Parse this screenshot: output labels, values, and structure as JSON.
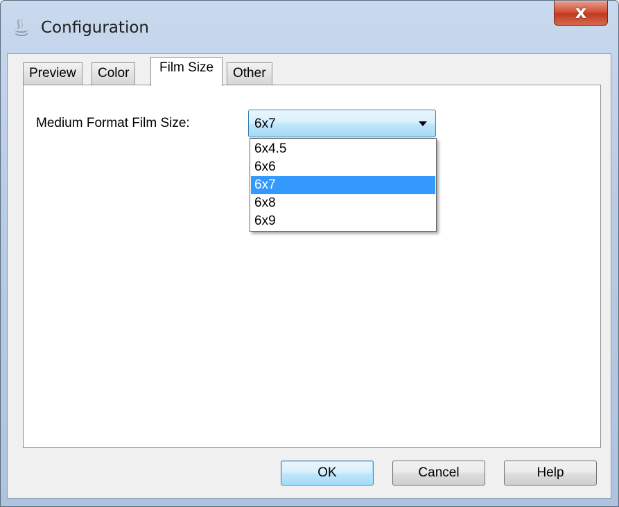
{
  "window": {
    "title": "Configuration",
    "close_label": "x"
  },
  "tabs": [
    {
      "label": "Preview",
      "active": false
    },
    {
      "label": "Color",
      "active": false
    },
    {
      "label": "Film Size",
      "active": true
    },
    {
      "label": "Other",
      "active": false
    }
  ],
  "film_size": {
    "label": "Medium Format Film Size:",
    "selected": "6x7",
    "options": [
      "6x4.5",
      "6x6",
      "6x7",
      "6x8",
      "6x9"
    ],
    "highlighted_option": "6x7"
  },
  "buttons": {
    "ok": "OK",
    "cancel": "Cancel",
    "help": "Help"
  },
  "colors": {
    "selection": "#3399ff",
    "close_button": "#c13a1f",
    "title_bar": "#b9cce4"
  }
}
